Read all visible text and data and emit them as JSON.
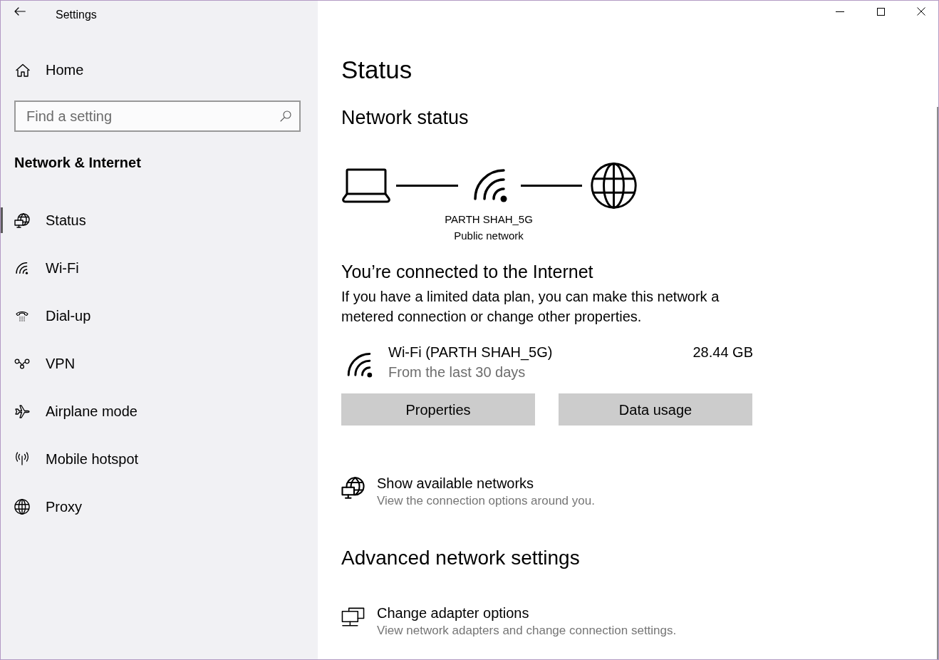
{
  "window": {
    "title": "Settings"
  },
  "sidebar": {
    "home": "Home",
    "search": {
      "placeholder": "Find a setting"
    },
    "section_title": "Network & Internet",
    "items": [
      {
        "label": "Status",
        "selected": true
      },
      {
        "label": "Wi-Fi",
        "selected": false
      },
      {
        "label": "Dial-up",
        "selected": false
      },
      {
        "label": "VPN",
        "selected": false
      },
      {
        "label": "Airplane mode",
        "selected": false
      },
      {
        "label": "Mobile hotspot",
        "selected": false
      },
      {
        "label": "Proxy",
        "selected": false
      }
    ]
  },
  "page_title": "Status",
  "network_status": {
    "heading": "Network status",
    "network_name": "PARTH SHAH_5G",
    "network_type": "Public network"
  },
  "connection": {
    "heading": "You’re connected to the Internet",
    "description": "If you have a limited data plan, you can make this network a metered connection or change other properties."
  },
  "usage": {
    "network": "Wi-Fi (PARTH SHAH_5G)",
    "period": "From the last 30 days",
    "amount": "28.44 GB"
  },
  "buttons": [
    "Properties",
    "Data usage"
  ],
  "links": [
    {
      "title": "Show available networks",
      "description": "View the connection options around you."
    }
  ],
  "advanced": {
    "heading": "Advanced network settings",
    "links": [
      {
        "title": "Change adapter options",
        "description": "View network adapters and change connection settings."
      }
    ]
  }
}
